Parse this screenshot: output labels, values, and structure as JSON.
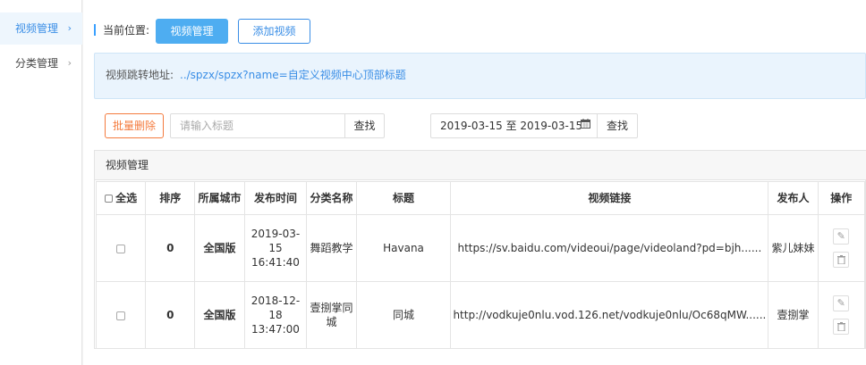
{
  "sidebar": {
    "items": [
      {
        "label": "视频管理",
        "chevron": "›"
      },
      {
        "label": "分类管理",
        "chevron": "›"
      }
    ]
  },
  "breadcrumb": {
    "label": "当前位置:"
  },
  "toolbar": {
    "video_manage": "视频管理",
    "add_video": "添加视频",
    "batch_delete": "批量删除",
    "find": "查找",
    "find_date": "查找"
  },
  "info": {
    "label": "视频跳转地址:",
    "link": "../spzx/spzx?name=自定义视频中心顶部标题"
  },
  "search": {
    "placeholder": "请输入标题",
    "value": ""
  },
  "date_range": {
    "value": "2019-03-15 至 2019-03-15",
    "icon": "calendar-icon"
  },
  "table": {
    "panel_title": "视频管理",
    "headers": {
      "select_all": "全选",
      "order": "排序",
      "city": "所属城市",
      "publish_time": "发布时间",
      "category": "分类名称",
      "title": "标题",
      "link": "视频链接",
      "publisher": "发布人",
      "actions": "操作"
    },
    "rows": [
      {
        "order": "0",
        "city": "全国版",
        "publish_time": "2019-03-15 16:41:40",
        "category": "舞蹈教学",
        "title": "Havana",
        "link": "https://sv.baidu.com/videoui/page/videoland?pd=bjh......",
        "publisher": "紫儿妹妹"
      },
      {
        "order": "0",
        "city": "全国版",
        "publish_time": "2018-12-18 13:47:00",
        "category": "壹捌掌同城",
        "title": "同城",
        "link": "http://vodkuje0nlu.vod.126.net/vodkuje0nlu/Oc68qMW......",
        "publisher": "壹捌掌"
      }
    ]
  },
  "colors": {
    "primary": "#4eadf1",
    "link": "#3a8ee6",
    "danger": "#f47b3e"
  }
}
